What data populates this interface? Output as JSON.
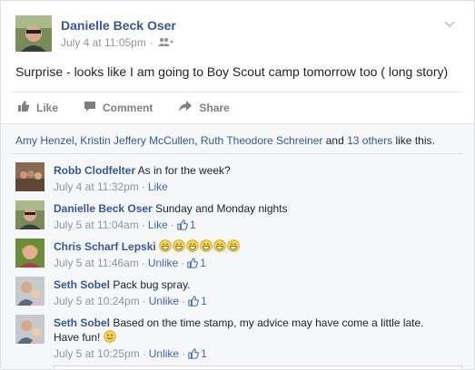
{
  "post": {
    "author": "Danielle Beck Oser",
    "timestamp": "July 4 at 11:05pm",
    "separator": "·",
    "text": "Surprise - looks like I am going to Boy Scout camp tomorrow too ( long story)"
  },
  "actions": {
    "like": "Like",
    "comment": "Comment",
    "share": "Share"
  },
  "likes": {
    "names": [
      "Amy Henzel",
      "Kristin Jeffery McCullen",
      "Ruth Theodore Schreiner"
    ],
    "sep1": ", ",
    "sep2": ", ",
    "and": " and ",
    "others": "13 others",
    "suffix": " like this."
  },
  "comments": [
    {
      "name": "Robb Clodfelter",
      "text": "As in for the week?",
      "time": "July 4 at 11:32pm",
      "dot": " · ",
      "action": "Like",
      "likes": ""
    },
    {
      "name": "Danielle Beck Oser",
      "text": "Sunday and Monday nights",
      "time": "July 5 at 11:04am",
      "dot": " · ",
      "action": "Like",
      "dot2": " · ",
      "likes": "1"
    },
    {
      "name": "Chris Scharf Lepski",
      "text": "",
      "emoji_count": 6,
      "time": "July 5 at 11:46am",
      "dot": " · ",
      "action": "Unlike",
      "dot2": " · ",
      "likes": "1"
    },
    {
      "name": "Seth Sobel",
      "text": "Pack bug spray.",
      "time": "July 5 at 10:24pm",
      "dot": " · ",
      "action": "Unlike",
      "dot2": " · ",
      "likes": "1"
    },
    {
      "name": "Seth Sobel",
      "text": "Based on the time stamp, my advice may have come a little late.",
      "text2": "Have fun!",
      "time": "July 5 at 10:25pm",
      "dot": " · ",
      "action": "Unlike",
      "dot2": " · ",
      "likes": "1"
    }
  ],
  "colors": {
    "link": "#365899",
    "meta": "#90949c",
    "like_blue": "#4267b2"
  },
  "icons": {
    "privacy": "friends-icon",
    "menu": "chevron-down-icon",
    "like": "thumbs-up-icon",
    "comment": "speech-bubble-icon",
    "share": "share-arrow-icon"
  }
}
